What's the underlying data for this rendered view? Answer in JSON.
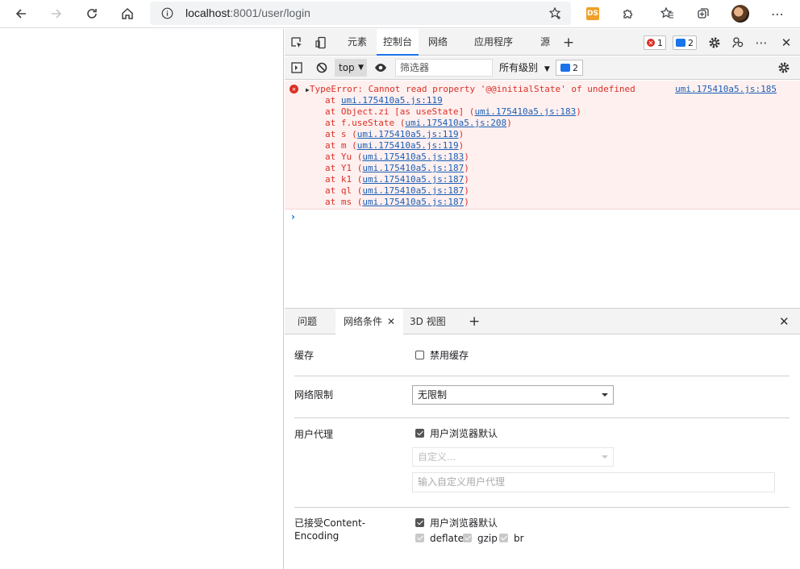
{
  "browser": {
    "url_host": "localhost",
    "url_path": ":8001/user/login",
    "ext_label": "DS"
  },
  "devtools": {
    "tabs": [
      "元素",
      "控制台",
      "网络",
      "应用程序",
      "源"
    ],
    "error_count": "1",
    "message_count": "2"
  },
  "console_toolbar": {
    "context": "top",
    "filter_placeholder": "筛选器",
    "levels": "所有级别",
    "issues_count": "2"
  },
  "error": {
    "message": "TypeError: Cannot read property '@@initialState' of undefined",
    "source": "umi.175410a5.js:185",
    "stack": [
      {
        "prefix": "at ",
        "link": "umi.175410a5.js:119",
        "suffix": "",
        "wrap": false
      },
      {
        "prefix": "at Object.zi [as useState] (",
        "link": "umi.175410a5.js:183",
        "suffix": ")",
        "wrap": true
      },
      {
        "prefix": "at f.useState (",
        "link": "umi.175410a5.js:208",
        "suffix": ")",
        "wrap": true
      },
      {
        "prefix": "at s (",
        "link": "umi.175410a5.js:119",
        "suffix": ")",
        "wrap": true
      },
      {
        "prefix": "at m (",
        "link": "umi.175410a5.js:119",
        "suffix": ")",
        "wrap": true
      },
      {
        "prefix": "at Yu (",
        "link": "umi.175410a5.js:183",
        "suffix": ")",
        "wrap": true
      },
      {
        "prefix": "at Y1 (",
        "link": "umi.175410a5.js:187",
        "suffix": ")",
        "wrap": true
      },
      {
        "prefix": "at k1 (",
        "link": "umi.175410a5.js:187",
        "suffix": ")",
        "wrap": true
      },
      {
        "prefix": "at ql (",
        "link": "umi.175410a5.js:187",
        "suffix": ")",
        "wrap": true
      },
      {
        "prefix": "at ms (",
        "link": "umi.175410a5.js:187",
        "suffix": ")",
        "wrap": true
      }
    ]
  },
  "drawer": {
    "tabs": [
      "问题",
      "网络条件",
      "3D 视图"
    ]
  },
  "network_conditions": {
    "cache_label": "缓存",
    "disable_cache": "禁用缓存",
    "throttling_label": "网络限制",
    "throttling_value": "无限制",
    "ua_label": "用户代理",
    "ua_default": "用户浏览器默认",
    "ua_custom_placeholder": "自定义...",
    "ua_input_placeholder": "输入自定义用户代理",
    "encoding_label_1": "已接受Content-",
    "encoding_label_2": "Encoding",
    "encoding_default": "用户浏览器默认",
    "encodings": [
      "deflate",
      "gzip",
      "br"
    ]
  }
}
